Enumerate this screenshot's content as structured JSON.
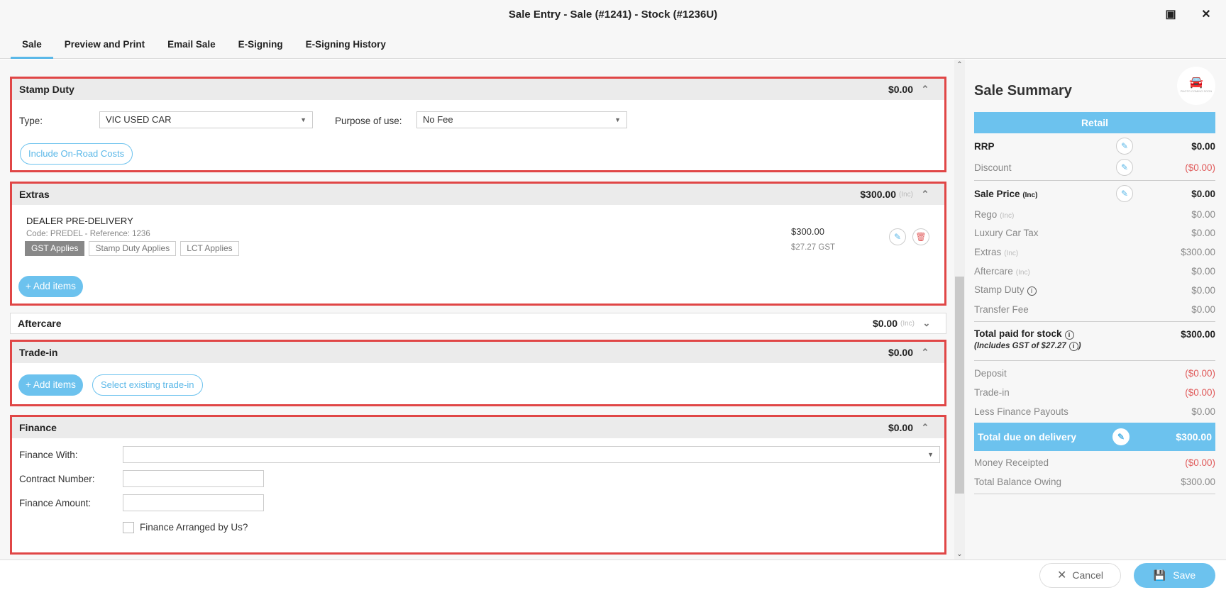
{
  "window": {
    "title": "Sale Entry - Sale (#1241) - Stock (#1236U)",
    "maximize_icon": "maximize-icon",
    "close_icon": "close-icon"
  },
  "tabs": [
    {
      "label": "Sale"
    },
    {
      "label": "Preview and Print"
    },
    {
      "label": "Email Sale"
    },
    {
      "label": "E-Signing"
    },
    {
      "label": "E-Signing History"
    }
  ],
  "stamp_duty": {
    "title": "Stamp Duty",
    "amount": "$0.00",
    "type_label": "Type:",
    "type_value": "VIC USED CAR",
    "purpose_label": "Purpose of use:",
    "purpose_value": "No Fee",
    "on_road_button": "Include On-Road Costs"
  },
  "extras": {
    "title": "Extras",
    "amount": "$300.00",
    "inc": "(Inc)",
    "item": {
      "name": "DEALER PRE-DELIVERY",
      "code": "Code: PREDEL - Reference: 1236",
      "tags": [
        "GST Applies",
        "Stamp Duty Applies",
        "LCT Applies"
      ],
      "price": "$300.00",
      "gst": "$27.27 GST"
    },
    "add_button": "Add items"
  },
  "aftercare": {
    "title": "Aftercare",
    "amount": "$0.00",
    "inc": "(Inc)"
  },
  "trade_in": {
    "title": "Trade-in",
    "amount": "$0.00",
    "add_button": "Add items",
    "select_button": "Select existing trade-in"
  },
  "finance": {
    "title": "Finance",
    "amount": "$0.00",
    "with_label": "Finance With:",
    "with_value": "",
    "contract_label": "Contract Number:",
    "contract_value": "",
    "amount_label": "Finance Amount:",
    "amount_value": "",
    "arranged_label": "Finance Arranged by Us?",
    "arranged_checked": false
  },
  "summary": {
    "title": "Sale Summary",
    "photo_text": "PHOTO COMING SOON",
    "mode": "Retail",
    "rrp": {
      "label": "RRP",
      "value": "$0.00"
    },
    "discount": {
      "label": "Discount",
      "value": "($0.00)"
    },
    "sale_price": {
      "label": "Sale Price",
      "inc": "(Inc)",
      "value": "$0.00"
    },
    "rego": {
      "label": "Rego",
      "inc": "(Inc)",
      "value": "$0.00"
    },
    "lct": {
      "label": "Luxury Car Tax",
      "value": "$0.00"
    },
    "extras": {
      "label": "Extras",
      "inc": "(Inc)",
      "value": "$300.00"
    },
    "aftercare": {
      "label": "Aftercare",
      "inc": "(Inc)",
      "value": "$0.00"
    },
    "stamp_duty": {
      "label": "Stamp Duty",
      "value": "$0.00"
    },
    "transfer": {
      "label": "Transfer Fee",
      "value": "$0.00"
    },
    "total_paid": {
      "label": "Total paid for stock",
      "value": "$300.00",
      "gst_note": "(Includes GST of $27.27"
    },
    "deposit": {
      "label": "Deposit",
      "value": "($0.00)"
    },
    "trade_in": {
      "label": "Trade-in",
      "value": "($0.00)"
    },
    "payouts": {
      "label": "Less Finance Payouts",
      "value": "$0.00"
    },
    "total_due": {
      "label": "Total due on delivery",
      "value": "$300.00"
    },
    "receipted": {
      "label": "Money Receipted",
      "value": "($0.00)"
    },
    "balance": {
      "label": "Total Balance Owing",
      "value": "$300.00"
    }
  },
  "footer": {
    "cancel": "Cancel",
    "save": "Save"
  }
}
